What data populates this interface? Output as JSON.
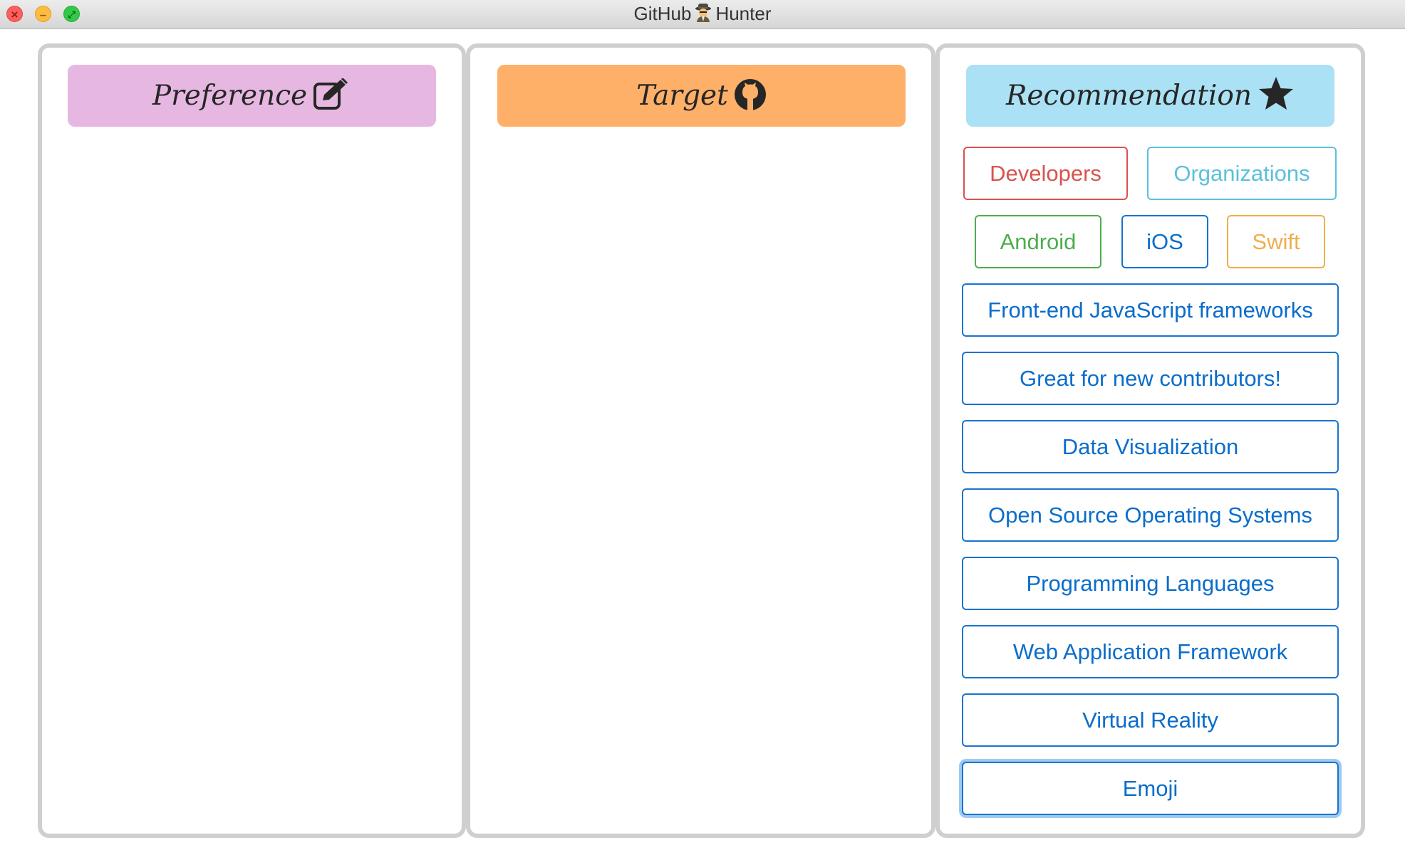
{
  "window": {
    "title_left": "GitHub",
    "title_right": "Hunter",
    "title_icon": "detective-emoji-icon"
  },
  "panels": {
    "preference": {
      "title": "Preference",
      "icon": "edit-icon"
    },
    "target": {
      "title": "Target",
      "icon": "github-octocat-icon"
    },
    "recommendation": {
      "title": "Recommendation",
      "icon": "star-icon"
    }
  },
  "recommendation_buttons": {
    "developers": "Developers",
    "organizations": "Organizations",
    "android": "Android",
    "ios": "iOS",
    "swift": "Swift",
    "topics": [
      "Front-end JavaScript frameworks",
      "Great for new contributors!",
      "Data Visualization",
      "Open Source Operating Systems",
      "Programming Languages",
      "Web Application Framework",
      "Virtual Reality",
      "Emoji"
    ]
  },
  "colors": {
    "preference_header": "#e6b8e1",
    "target_header": "#ffb068",
    "recommendation_header": "#abe1f4",
    "developers": "#d9534f",
    "organizations": "#5bc0de",
    "android": "#4cae4c",
    "ios": "#0a6dcb",
    "swift": "#f0ad4e",
    "topic_button": "#0a6dcb"
  }
}
